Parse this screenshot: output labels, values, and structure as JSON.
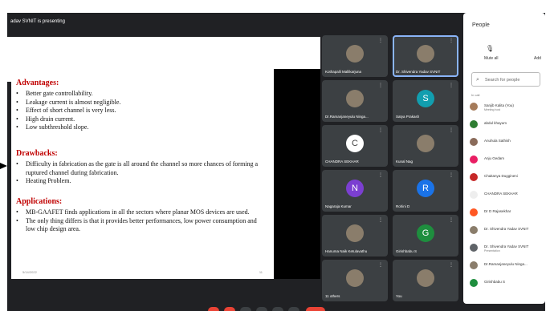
{
  "header": {
    "presenting": "adav SVNIT is presenting"
  },
  "slide": {
    "advantages_title": "Advantages:",
    "advantages": [
      "Better gate controllability.",
      "Leakage current is almost negligible.",
      "Effect of short channel is very less.",
      "High drain current.",
      "Low subthreshold slope."
    ],
    "drawbacks_title": "Drawbacks:",
    "drawbacks": [
      "Difficulty in fabrication as the gate is all around the channel so more chances of forming a ruptured channel during fabrication.",
      "Heating Problem."
    ],
    "applications_title": "Applications:",
    "applications": [
      "MB-GAAFET finds applications in all the sectors where planar MOS devices are used.",
      "The only thing differs is that it provides better performances, low power consumption and low chip design area."
    ],
    "footer_date": "5/14/2022",
    "footer_page": "11"
  },
  "tiles": [
    {
      "name": "Kothapalli Mallikarjuna",
      "avatar": "",
      "color": "#8a7d6b"
    },
    {
      "name": "Dr. Shivendra Yadav SVNIT",
      "avatar": "",
      "color": "#8a7d6b"
    },
    {
      "name": "Dr.Ramanjaneyulu Ninga...",
      "avatar": "",
      "color": "#8a7d6b"
    },
    {
      "name": "Satya Prakash",
      "avatar": "S",
      "color": "#129eaf"
    },
    {
      "name": "CHANDRA SEKHAR",
      "avatar": "C",
      "color": "#ffffff"
    },
    {
      "name": "Kunal Nag",
      "avatar": "",
      "color": "#8a7d6b"
    },
    {
      "name": "Nagaraja Kumar",
      "avatar": "N",
      "color": "#7b3fd1"
    },
    {
      "name": "Rohini D",
      "avatar": "R",
      "color": "#1a73e8"
    },
    {
      "name": "Hanuma Naik Ketulavathu",
      "avatar": "",
      "color": "#8a7d6b"
    },
    {
      "name": "Girishbabu S",
      "avatar": "G",
      "color": "#1e8e3e"
    },
    {
      "name": "11 others",
      "avatar": "",
      "color": "#8a7d6b"
    },
    {
      "name": "You",
      "avatar": "",
      "color": "#8a7d6b"
    }
  ],
  "people_panel": {
    "title": "People",
    "mute_all": "Mute all",
    "add": "Add",
    "search_placeholder": "Search for people",
    "in_call": "In call",
    "people": [
      {
        "name": "Sanjib Kalita (You)",
        "sub": "Meeting host",
        "color": "#a57b5a"
      },
      {
        "name": "abdul khayum",
        "sub": "",
        "color": "#2e7d32"
      },
      {
        "name": "Anuhula Sathish",
        "sub": "",
        "color": "#8a6b5a"
      },
      {
        "name": "Anju Gedam",
        "sub": "",
        "color": "#e91e63"
      },
      {
        "name": "Chaitanya Duggineni",
        "sub": "",
        "color": "#c62828"
      },
      {
        "name": "CHANDRA SEKHAR",
        "sub": "",
        "color": "#eeeeee"
      },
      {
        "name": "Dr D Rajasekhar",
        "sub": "",
        "color": "#ff5722"
      },
      {
        "name": "Dr. Shivendra Yadav SVNIT",
        "sub": "",
        "color": "#8a7d6b"
      },
      {
        "name": "Dr. Shivendra Yadav SVNIT",
        "sub": "Presentation",
        "color": "#5f6368"
      },
      {
        "name": "Dr.Ramanjaneyulu Ninga...",
        "sub": "",
        "color": "#8a7d6b"
      },
      {
        "name": "Girishbabu S",
        "sub": "",
        "color": "#1e8e3e"
      }
    ]
  }
}
